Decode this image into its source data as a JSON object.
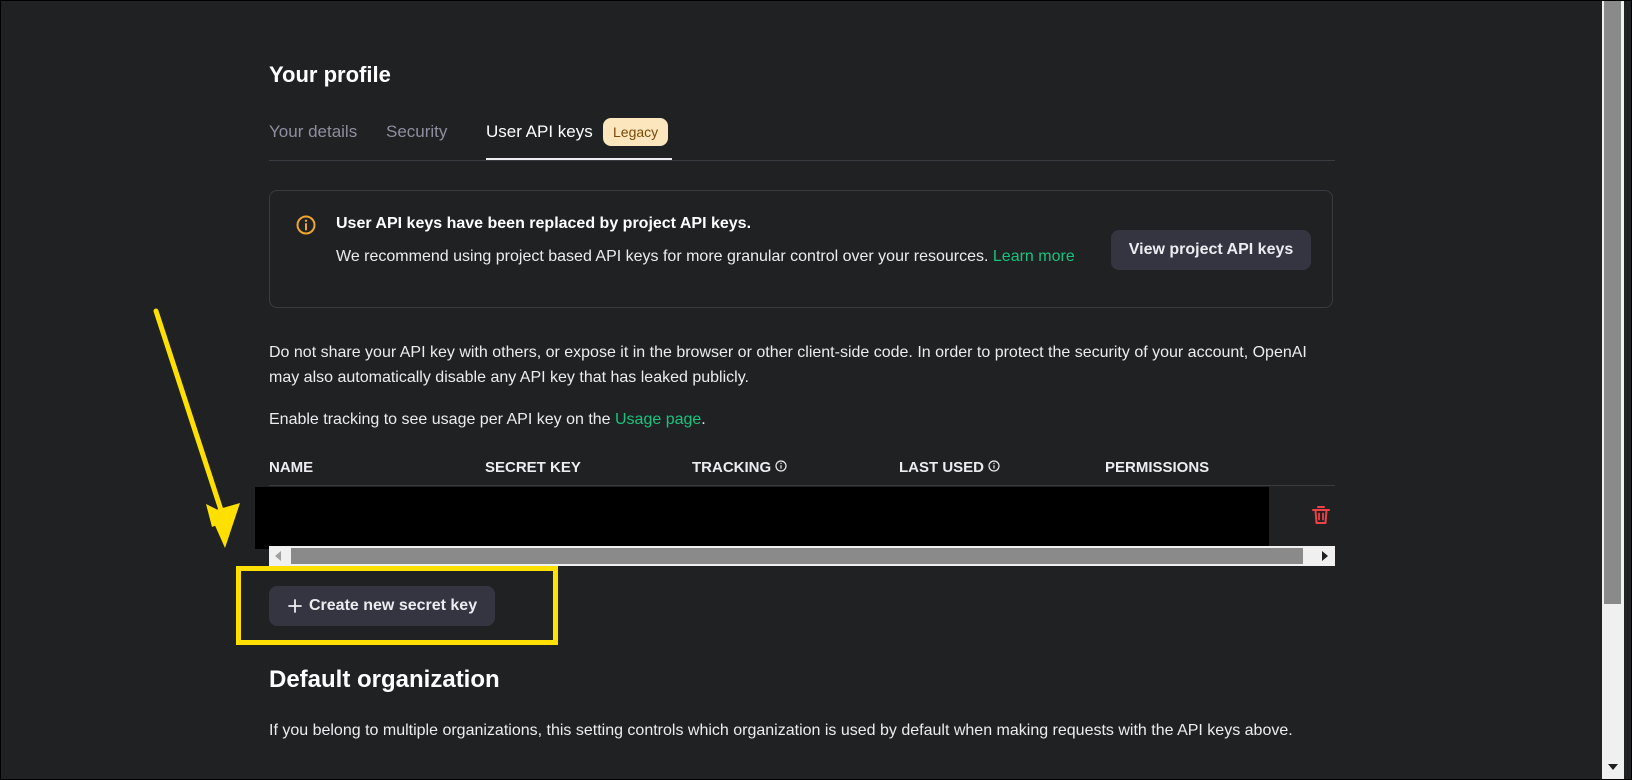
{
  "page": {
    "title": "Your profile"
  },
  "tabs": [
    {
      "label": "Your details",
      "active": false
    },
    {
      "label": "Security",
      "active": false
    },
    {
      "label": "User API keys",
      "active": true,
      "badge": "Legacy"
    }
  ],
  "notice": {
    "icon": "info-circle-icon",
    "title": "User API keys have been replaced by project API keys.",
    "body": "We recommend using project based API keys for more granular control over your resources.",
    "link_label": "Learn more",
    "button_label": "View project API keys"
  },
  "intro": {
    "warning": "Do not share your API key with others, or expose it in the browser or other client-side code. In order to protect the security of your account, OpenAI may also automatically disable any API key that has leaked publicly.",
    "tracking_prefix": "Enable tracking to see usage per API key on the ",
    "tracking_link": "Usage page",
    "tracking_suffix": "."
  },
  "table": {
    "columns": [
      "NAME",
      "SECRET KEY",
      "TRACKING",
      "LAST USED",
      "PERMISSIONS"
    ],
    "row_action_icon": "trash-icon"
  },
  "create_button": {
    "icon": "plus-icon",
    "label": "Create new secret key"
  },
  "default_org": {
    "title": "Default organization",
    "description": "If you belong to multiple organizations, this setting controls which organization is used by default when making requests with the API keys above."
  },
  "colors": {
    "background": "#202123",
    "link": "#19c37d",
    "badge_bg": "#fbe6be",
    "badge_text": "#7a4a06",
    "info_icon": "#f0a52f",
    "delete_icon": "#ef4146",
    "annotation": "#ffe000"
  }
}
